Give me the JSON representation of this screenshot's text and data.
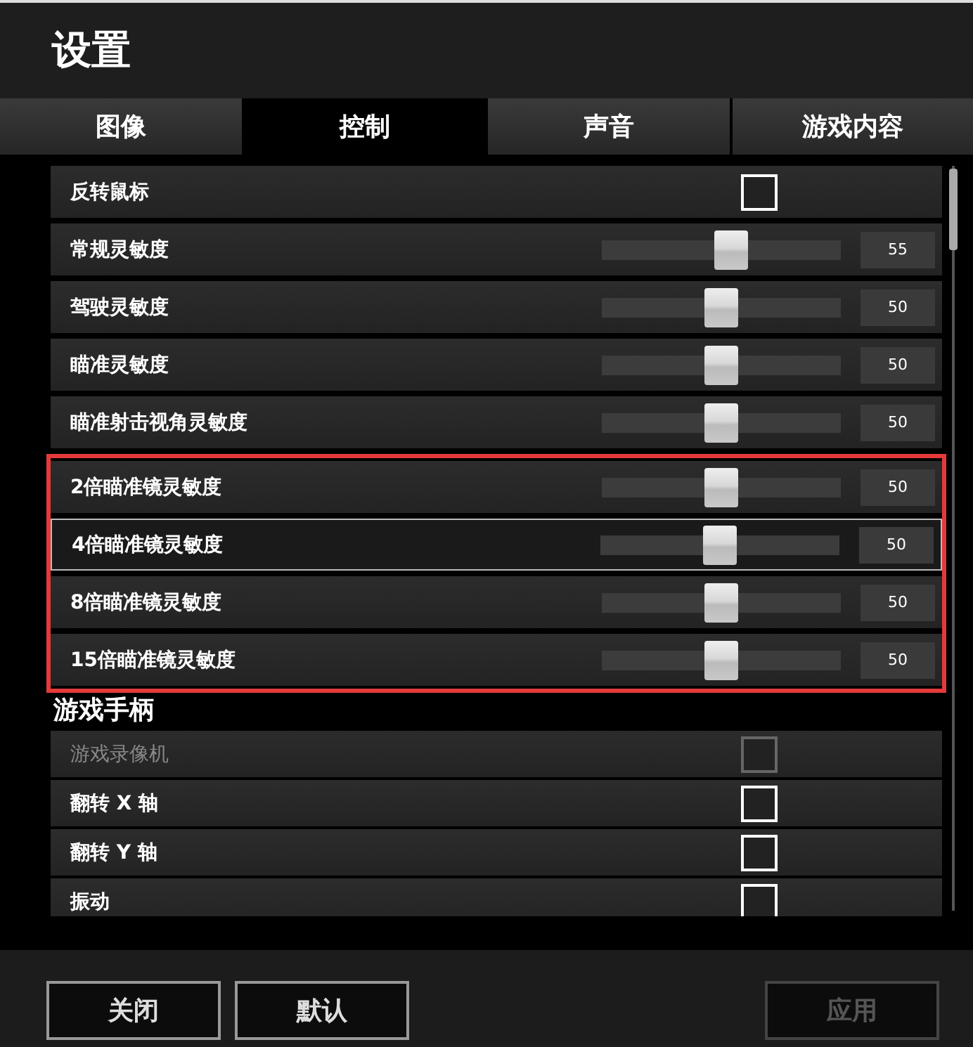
{
  "title": "设置",
  "tabs": [
    {
      "label": "图像",
      "selected": false
    },
    {
      "label": "控制",
      "selected": true
    },
    {
      "label": "声音",
      "selected": false
    },
    {
      "label": "游戏内容",
      "selected": false
    }
  ],
  "sections": [
    {
      "groups": [
        {
          "outlined": false,
          "items": [
            {
              "kind": "checkbox",
              "label": "反转鼠标",
              "checked": false,
              "disabled": false,
              "highlighted": false
            },
            {
              "kind": "slider",
              "label": "常规灵敏度",
              "level": 0.55,
              "value": "55",
              "highlighted": false
            },
            {
              "kind": "slider",
              "label": "驾驶灵敏度",
              "level": 0.5,
              "value": "50",
              "highlighted": false
            },
            {
              "kind": "slider",
              "label": "瞄准灵敏度",
              "level": 0.5,
              "value": "50",
              "highlighted": false
            },
            {
              "kind": "slider",
              "label": "瞄准射击视角灵敏度",
              "level": 0.5,
              "value": "50",
              "highlighted": false
            }
          ]
        },
        {
          "outlined": true,
          "items": [
            {
              "kind": "slider",
              "label": "2倍瞄准镜灵敏度",
              "level": 0.5,
              "value": "50",
              "highlighted": false
            },
            {
              "kind": "slider",
              "label": "4倍瞄准镜灵敏度",
              "level": 0.5,
              "value": "50",
              "highlighted": true
            },
            {
              "kind": "slider",
              "label": "8倍瞄准镜灵敏度",
              "level": 0.5,
              "value": "50",
              "highlighted": false
            },
            {
              "kind": "slider",
              "label": "15倍瞄准镜灵敏度",
              "level": 0.5,
              "value": "50",
              "highlighted": false
            }
          ]
        }
      ]
    },
    {
      "heading": "游戏手柄",
      "groups": [
        {
          "outlined": false,
          "items": [
            {
              "kind": "checkbox",
              "label": "游戏录像机",
              "checked": false,
              "disabled": true,
              "highlighted": false
            },
            {
              "kind": "checkbox",
              "label": "翻转 X 轴",
              "checked": false,
              "disabled": false,
              "highlighted": false
            },
            {
              "kind": "checkbox",
              "label": "翻转 Y 轴",
              "checked": false,
              "disabled": false,
              "highlighted": false
            },
            {
              "kind": "checkbox",
              "label": "振动",
              "checked": false,
              "disabled": false,
              "highlighted": false
            }
          ]
        }
      ]
    }
  ],
  "buttons": [
    {
      "label": "关闭",
      "disabled": false
    },
    {
      "label": "默认",
      "disabled": false
    },
    {
      "label": "应用",
      "disabled": true
    }
  ]
}
